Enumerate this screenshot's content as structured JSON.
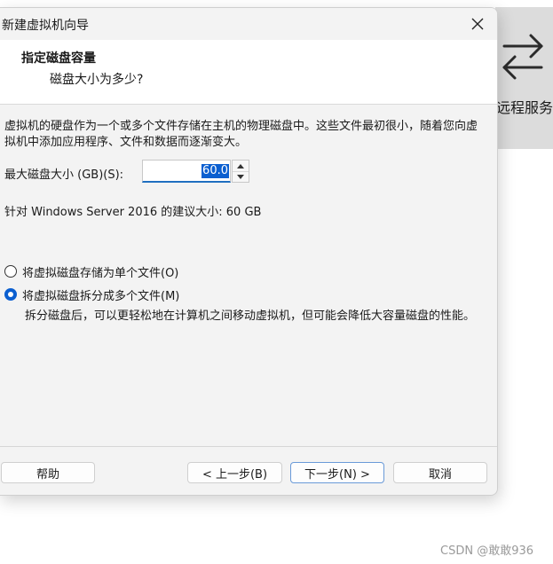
{
  "background": {
    "remote_service_label": "远程服务",
    "watermark": "CSDN @敢敢936"
  },
  "dialog": {
    "title": "新建虚拟机向导",
    "header": {
      "title": "指定磁盘容量",
      "subtitle": "磁盘大小为多少?"
    },
    "description": "虚拟机的硬盘作为一个或多个文件存储在主机的物理磁盘中。这些文件最初很小，随着您向虚拟机中添加应用程序、文件和数据而逐渐变大。",
    "max_disk": {
      "label": "最大磁盘大小 (GB)(S):",
      "value": "60.0"
    },
    "recommendation": "针对 Windows Server 2016 的建议大小: 60 GB",
    "storage_options": [
      {
        "label": "将虚拟磁盘存储为单个文件(O)",
        "selected": false
      },
      {
        "label": "将虚拟磁盘拆分成多个文件(M)",
        "selected": true
      }
    ],
    "split_description": "拆分磁盘后，可以更轻松地在计算机之间移动虚拟机，但可能会降低大容量磁盘的性能。",
    "buttons": {
      "help": "帮助",
      "back": "< 上一步(B)",
      "next": "下一步(N) >",
      "cancel": "取消"
    }
  },
  "colors": {
    "accent": "#0b5fd0",
    "dialog_bg": "#f3f3f3",
    "header_bg": "#ffffff"
  }
}
